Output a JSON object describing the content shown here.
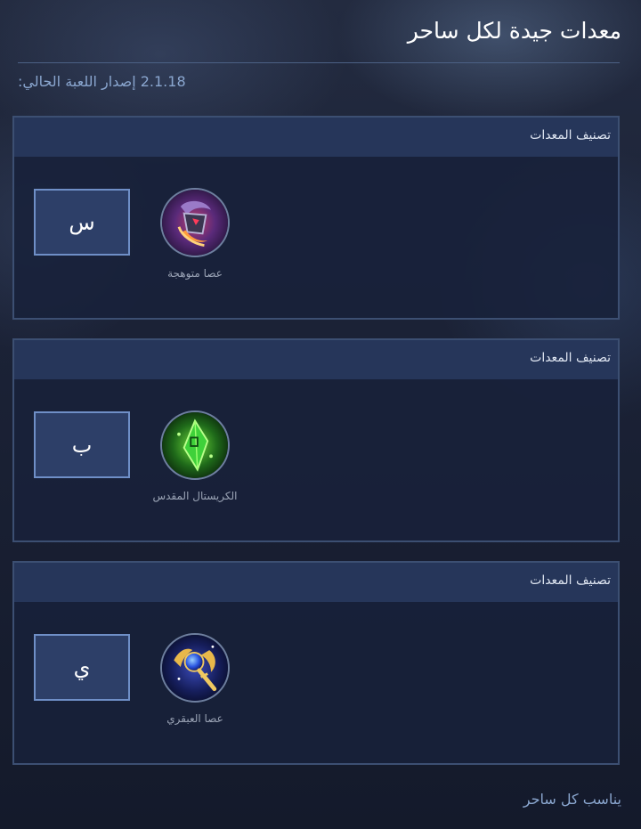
{
  "page": {
    "title": "معدات جيدة لكل ساحر",
    "version_line": "2.1.18 إصدار اللعبة الحالي:",
    "footer_note": "يناسب كل ساحر"
  },
  "cards": [
    {
      "header": "تصنيف المعدات",
      "grade": "س",
      "item_name": "عصا متوهجة",
      "icon": "flaming-staff-icon"
    },
    {
      "header": "تصنيف المعدات",
      "grade": "ب",
      "item_name": "الكريستال المقدس",
      "icon": "holy-crystal-icon"
    },
    {
      "header": "تصنيف المعدات",
      "grade": "ي",
      "item_name": "عصا العبقري",
      "icon": "genius-wand-icon"
    }
  ],
  "colors": {
    "background": "#161b2e",
    "card_header": "#26365a",
    "card_border": "#3c4f72",
    "grade_box_fill": "#2d3f68",
    "grade_box_border": "#6f8fc7",
    "accent_text": "#8aa6cf"
  }
}
